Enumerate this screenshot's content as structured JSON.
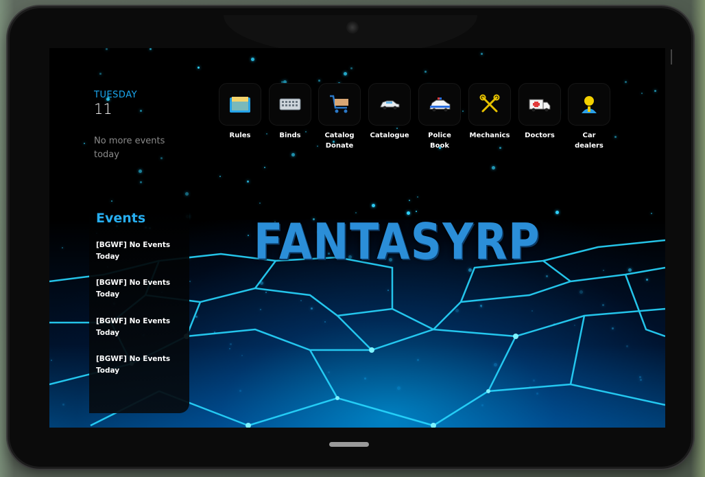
{
  "date": {
    "day_name": "TUESDAY",
    "day_number": "11",
    "no_events_text": "No more events today"
  },
  "events": {
    "title": "Events",
    "items": [
      {
        "text": "[BGWF] No Events Today"
      },
      {
        "text": "[BGWF] No Events Today"
      },
      {
        "text": "[BGWF] No Events Today"
      },
      {
        "text": "[BGWF] No Events Today"
      }
    ]
  },
  "apps": [
    {
      "label": "Rules",
      "icon": "folder-icon"
    },
    {
      "label": "Binds",
      "icon": "keyboard-icon"
    },
    {
      "label": "Catalog Donate",
      "icon": "shopping-cart-icon"
    },
    {
      "label": "Catalogue",
      "icon": "car-icon"
    },
    {
      "label": "Police Book",
      "icon": "police-car-icon"
    },
    {
      "label": "Mechanics",
      "icon": "wrench-icon"
    },
    {
      "label": "Doctors",
      "icon": "ambulance-icon"
    },
    {
      "label": "Car dealers",
      "icon": "dealer-person-icon"
    }
  ],
  "wallpaper": {
    "logo_text": "FANTASYRP"
  },
  "colors": {
    "accent": "#1aa6ee",
    "neon": "#2fd6ff",
    "screen_bg": "#000000"
  }
}
